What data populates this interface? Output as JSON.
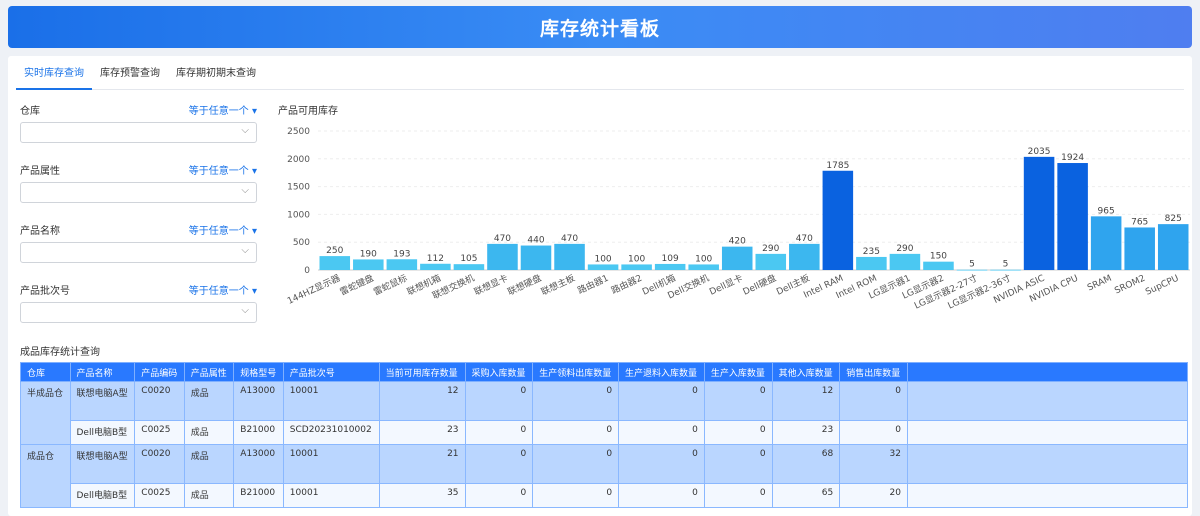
{
  "header": {
    "title": "库存统计看板"
  },
  "tabs": [
    "实时库存查询",
    "库存预警查询",
    "库存期初期末查询"
  ],
  "filters": [
    {
      "label": "仓库",
      "op": "等于任意一个 ▾",
      "value": ""
    },
    {
      "label": "产品属性",
      "op": "等于任意一个 ▾",
      "value": ""
    },
    {
      "label": "产品名称",
      "op": "等于任意一个 ▾",
      "value": ""
    },
    {
      "label": "产品批次号",
      "op": "等于任意一个 ▾",
      "value": ""
    }
  ],
  "chart_data": {
    "type": "bar",
    "title": "产品可用库存",
    "categories": [
      "144HZ显示器",
      "雷蛇键盘",
      "雷蛇鼠标",
      "联想机箱",
      "联想交换机",
      "联想显卡",
      "联想硬盘",
      "联想主板",
      "路由器1",
      "路由器2",
      "Dell机箱",
      "Dell交换机",
      "Dell显卡",
      "Dell硬盘",
      "Dell主板",
      "Intel RAM",
      "Intel ROM",
      "LG显示器1",
      "LG显示器2",
      "LG显示器2-27寸",
      "LG显示器2-36寸",
      "NVIDIA ASIC",
      "NVIDIA CPU",
      "SRAM",
      "SROM2",
      "SupCPU"
    ],
    "values": [
      250,
      190,
      193,
      112,
      105,
      470,
      440,
      470,
      100,
      100,
      109,
      100,
      420,
      290,
      470,
      1785,
      235,
      290,
      150,
      5,
      5,
      2035,
      1924,
      965,
      765,
      825
    ],
    "yticks": [
      "0",
      "500",
      "1000",
      "1500",
      "2000",
      "2500"
    ],
    "ylim": [
      0,
      2500
    ],
    "grid": true
  },
  "table": {
    "title": "成品库存统计查询",
    "columns": [
      "仓库",
      "产品名称",
      "产品编码",
      "产品属性",
      "规格型号",
      "产品批次号",
      "当前可用库存数量",
      "采购入库数量",
      "生产领料出库数量",
      "生产退料入库数量",
      "生产入库数量",
      "其他入库数量",
      "销售出库数量"
    ],
    "groups": [
      {
        "warehouse": "半成品仓",
        "rows": [
          [
            "联想电脑A型",
            "C0020",
            "成品",
            "A13000",
            "10001",
            "12",
            "0",
            "0",
            "0",
            "0",
            "12",
            "0"
          ],
          [
            "Dell电脑B型",
            "C0025",
            "成品",
            "B21000",
            "SCD20231010002",
            "23",
            "0",
            "0",
            "0",
            "0",
            "23",
            "0"
          ]
        ]
      },
      {
        "warehouse": "成品仓",
        "rows": [
          [
            "联想电脑A型",
            "C0020",
            "成品",
            "A13000",
            "10001",
            "21",
            "0",
            "0",
            "0",
            "0",
            "68",
            "32"
          ],
          [
            "Dell电脑B型",
            "C0025",
            "成品",
            "B21000",
            "10001",
            "35",
            "0",
            "0",
            "0",
            "0",
            "65",
            "20"
          ]
        ]
      }
    ]
  }
}
